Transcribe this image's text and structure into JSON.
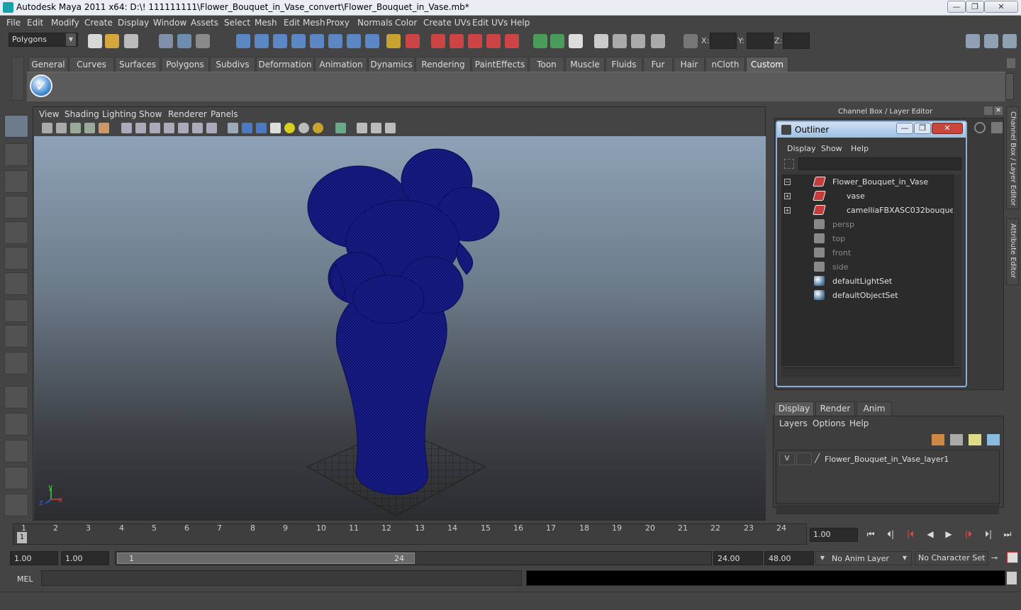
{
  "window": {
    "title": "Autodesk Maya 2011 x64: D:\\! 111111111\\Flower_Bouquet_in_Vase_convert\\Flower_Bouquet_in_Vase.mb*",
    "minimize_glyph": "—",
    "maximize_glyph": "❐",
    "close_glyph": "✕"
  },
  "menubar": [
    "File",
    "Edit",
    "Modify",
    "Create",
    "Display",
    "Window",
    "Assets",
    "Select",
    "Mesh",
    "Edit Mesh",
    "Proxy",
    "Normals",
    "Color",
    "Create UVs",
    "Edit UVs",
    "Help"
  ],
  "statusline": {
    "menu_set": "Polygons",
    "coord_labels": [
      "X:",
      "Y:",
      "Z:"
    ]
  },
  "shelf": {
    "tabs": [
      "General",
      "Curves",
      "Surfaces",
      "Polygons",
      "Subdivs",
      "Deformation",
      "Animation",
      "Dynamics",
      "Rendering",
      "PaintEffects",
      "Toon",
      "Muscle",
      "Fluids",
      "Fur",
      "Hair",
      "nCloth",
      "Custom"
    ],
    "active_tab": "Custom"
  },
  "viewport": {
    "menu": [
      "View",
      "Shading",
      "Lighting",
      "Show",
      "Renderer",
      "Panels"
    ],
    "axis_labels": {
      "y": "y",
      "x": "x",
      "z": "z"
    }
  },
  "channel_box": {
    "title": "Channel Box / Layer Editor"
  },
  "side_tabs": [
    "Channel Box / Layer Editor",
    "Attribute Editor"
  ],
  "outliner": {
    "title": "Outliner",
    "menu": [
      "Display",
      "Show",
      "Help"
    ],
    "items": [
      {
        "label": "Flower_Bouquet_in_Vase",
        "expander": "−"
      },
      {
        "label": "vase",
        "expander": "+"
      },
      {
        "label": "camelliaFBXASC032bouquet",
        "expander": "+"
      },
      {
        "label": "persp"
      },
      {
        "label": "top"
      },
      {
        "label": "front"
      },
      {
        "label": "side"
      },
      {
        "label": "defaultLightSet"
      },
      {
        "label": "defaultObjectSet"
      }
    ]
  },
  "layer_editor": {
    "tabs": [
      "Display",
      "Render",
      "Anim"
    ],
    "active_tab": "Display",
    "menu": [
      "Layers",
      "Options",
      "Help"
    ],
    "layers": [
      {
        "visible": "V",
        "name": "Flower_Bouquet_in_Vase_layer1"
      }
    ]
  },
  "timeline": {
    "ticks": [
      "1",
      "2",
      "3",
      "4",
      "5",
      "6",
      "7",
      "8",
      "9",
      "10",
      "11",
      "12",
      "13",
      "14",
      "15",
      "16",
      "17",
      "18",
      "19",
      "20",
      "21",
      "22",
      "23",
      "24"
    ],
    "current_frame_marker": "1",
    "current_time": "1.00"
  },
  "range": {
    "start_time": "1.00",
    "playback_start": "1.00",
    "range_start_label": "1",
    "range_end_label": "24",
    "playback_end": "24.00",
    "end_time": "48.00",
    "anim_layer": "No Anim Layer",
    "character_set": "No Character Set"
  },
  "playback_buttons": [
    "⏮",
    "⏴|",
    "|⏴",
    "◀",
    "▶",
    "|⏵",
    "⏵|",
    "⏭"
  ],
  "command_line": {
    "label": "MEL"
  },
  "colors": {
    "wireframe": "#0d1170",
    "viewport_top": "#8ea2b7",
    "viewport_bottom": "#2b2c2f",
    "outliner_border": "#8bb0d8"
  }
}
